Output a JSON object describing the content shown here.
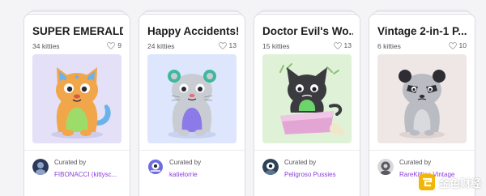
{
  "cards": [
    {
      "title": "SUPER EMERALD...",
      "count": "34 kitties",
      "likes": "9",
      "curated_label": "Curated by",
      "curator": "FIBONACCI (kittysc...",
      "art_bg": "#e3e0f8",
      "cat_color": "#f2a64a",
      "belly_color": "#9edc6a",
      "avatar_color": "#2c3a58"
    },
    {
      "title": "Happy Accidents!",
      "count": "24 kitties",
      "likes": "13",
      "curated_label": "Curated by",
      "curator": "katielorrie",
      "art_bg": "#dde6fc",
      "cat_color": "#c9cdd3",
      "belly_color": "#8b7ae8",
      "avatar_color": "#6b6de0"
    },
    {
      "title": "Doctor Evil's Wo...",
      "count": "15 kitties",
      "likes": "13",
      "curated_label": "Curated by",
      "curator": "Peligroso Pussies",
      "art_bg": "#dff2d8",
      "cat_color": "#3b3b3f",
      "belly_color": "#6cd46a",
      "avatar_color": "#2f4258"
    },
    {
      "title": "Vintage 2-in-1 P...",
      "count": "6 kitties",
      "likes": "10",
      "curated_label": "Curated by",
      "curator": "RareKitties Vintage",
      "art_bg": "#efe7e5",
      "cat_color": "#b9bcc2",
      "belly_color": "#d8dade",
      "avatar_color": "#5a5a60"
    }
  ],
  "watermark": {
    "text": "金色财经"
  },
  "colors": {
    "accent": "#8a3fd6",
    "heart_stroke": "#9a9aa3",
    "watermark_accent": "#f2b705"
  }
}
